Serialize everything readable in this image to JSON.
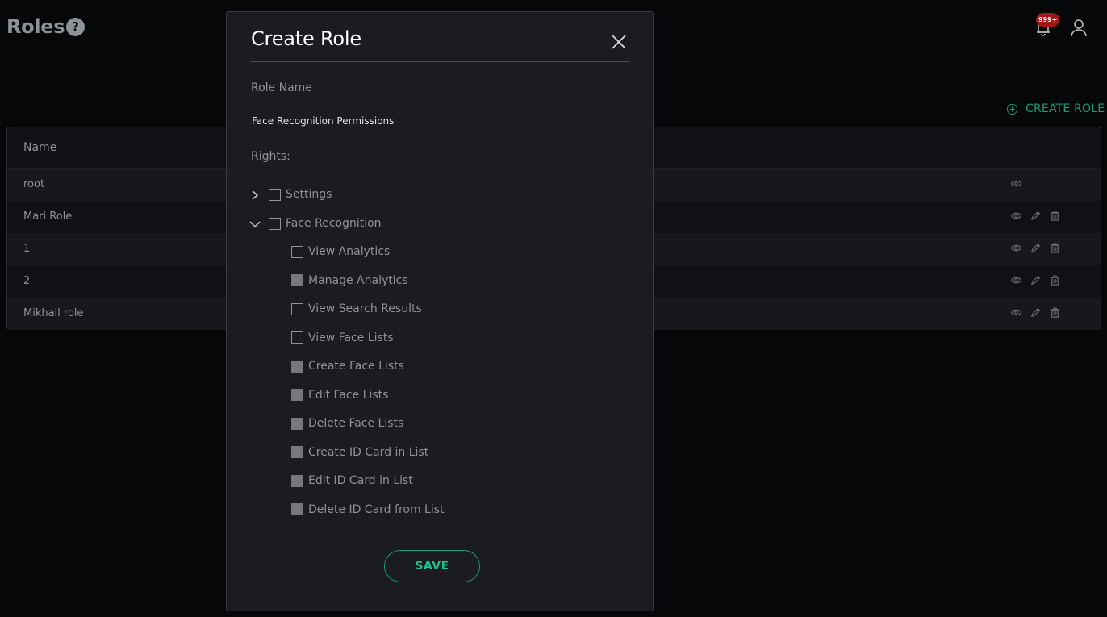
{
  "header": {
    "title": "Roles",
    "help_glyph": "?",
    "notification_badge": "999+",
    "create_role_label": "CREATE ROLE"
  },
  "table": {
    "columns": {
      "name": "Name"
    },
    "rows": [
      {
        "name": "root",
        "actions": [
          "view"
        ]
      },
      {
        "name": "Mari Role",
        "actions": [
          "view",
          "edit",
          "delete"
        ]
      },
      {
        "name": "1",
        "actions": [
          "view",
          "edit",
          "delete"
        ]
      },
      {
        "name": "2",
        "actions": [
          "view",
          "edit",
          "delete"
        ]
      },
      {
        "name": "Mikhail role",
        "actions": [
          "view",
          "edit",
          "delete"
        ]
      }
    ]
  },
  "modal": {
    "title": "Create Role",
    "role_name_label": "Role Name",
    "role_name_value": "Face Recognition Permissions",
    "rights_label": "Rights:",
    "save_label": "SAVE",
    "rights": [
      {
        "label": "Settings",
        "expanded": false,
        "checked": false,
        "children": []
      },
      {
        "label": "Face Recognition",
        "expanded": true,
        "checked": false,
        "children": [
          {
            "label": "View Analytics",
            "state": "unchecked"
          },
          {
            "label": "Manage Analytics",
            "state": "disabled"
          },
          {
            "label": "View Search Results",
            "state": "unchecked"
          },
          {
            "label": "View Face Lists",
            "state": "unchecked"
          },
          {
            "label": "Create Face Lists",
            "state": "disabled"
          },
          {
            "label": "Edit Face Lists",
            "state": "disabled"
          },
          {
            "label": "Delete Face Lists",
            "state": "disabled"
          },
          {
            "label": "Create ID Card in List",
            "state": "disabled"
          },
          {
            "label": "Edit ID Card in List",
            "state": "disabled"
          },
          {
            "label": "Delete ID Card from List",
            "state": "disabled"
          }
        ]
      }
    ]
  },
  "colors": {
    "accent": "#1c9a72",
    "badge": "#a3161c",
    "background": "#060708",
    "modal_bg": "#1b1c21"
  },
  "icons": {
    "help": "help-icon",
    "notifications": "bell-icon",
    "user": "user-icon",
    "create": "plus-circle-icon",
    "close": "close-icon",
    "view": "eye-icon",
    "edit": "pencil-icon",
    "delete": "trash-icon"
  }
}
